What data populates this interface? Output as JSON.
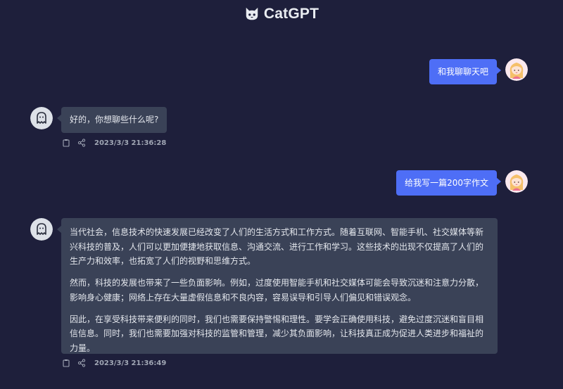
{
  "app": {
    "title": "CatGPT"
  },
  "messages": [
    {
      "role": "user",
      "text": "和我聊聊天吧",
      "avatar": "girl-avatar-icon"
    },
    {
      "role": "bot",
      "paragraphs": [
        "好的，你想聊些什么呢?"
      ],
      "timestamp": "2023/3/3 21:36:28",
      "avatar": "ghost-avatar-icon"
    },
    {
      "role": "user",
      "text": "给我写一篇200字作文",
      "avatar": "girl-avatar-icon"
    },
    {
      "role": "bot",
      "paragraphs": [
        "当代社会，信息技术的快速发展已经改变了人们的生活方式和工作方式。随着互联网、智能手机、社交媒体等新兴科技的普及，人们可以更加便捷地获取信息、沟通交流、进行工作和学习。这些技术的出现不仅提高了人们的生产力和效率，也拓宽了人们的视野和思维方式。",
        "然而，科技的发展也带来了一些负面影响。例如，过度使用智能手机和社交媒体可能会导致沉迷和注意力分散，影响身心健康；网络上存在大量虚假信息和不良内容，容易误导和引导人们偏见和错误观念。",
        "因此，在享受科技带来便利的同时，我们也需要保持警惕和理性。要学会正确使用科技，避免过度沉迷和盲目相信信息。同时，我们也需要加强对科技的监管和管理，减少其负面影响，让科技真正成为促进人类进步和福祉的力量。"
      ],
      "timestamp": "2023/3/3 21:36:49",
      "avatar": "ghost-avatar-icon"
    }
  ],
  "icons": {
    "copy": "clipboard-icon",
    "share": "share-icon",
    "logo": "cat-logo-icon"
  },
  "colors": {
    "background": "#1e1f3b",
    "user_bubble": "#4e6ef6",
    "bot_bubble": "#3a4257",
    "meta_text": "#a0a6b4"
  }
}
